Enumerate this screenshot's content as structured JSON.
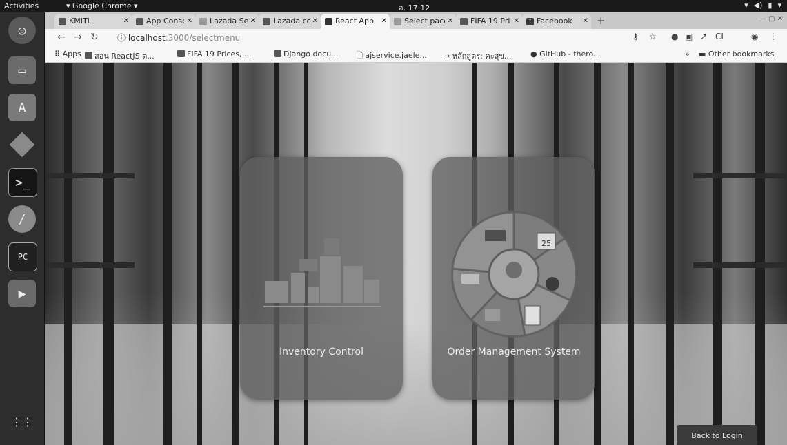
{
  "desktop": {
    "activities": "Activities",
    "app_menu": "Google Chrome",
    "clock": "อ. 17:12"
  },
  "tabs": [
    {
      "label": "KMITL"
    },
    {
      "label": "App Consol"
    },
    {
      "label": "Lazada Sel"
    },
    {
      "label": "Lazada.co"
    },
    {
      "label": "React App"
    },
    {
      "label": "Select pace"
    },
    {
      "label": "FIFA 19 Pri"
    },
    {
      "label": "Facebook"
    }
  ],
  "address": {
    "host": "localhost",
    "path": ":3000/selectmenu"
  },
  "bookmarks": [
    {
      "label": "Apps"
    },
    {
      "label": "สอน ReactJS ต..."
    },
    {
      "label": "FIFA 19 Prices, ..."
    },
    {
      "label": "Django docu..."
    },
    {
      "label": "ajservice.jaele..."
    },
    {
      "label": "หลักสูตร: คะสุข..."
    },
    {
      "label": "GitHub - thero..."
    },
    {
      "label": "Other bookmarks"
    }
  ],
  "page": {
    "inventory_label": "Inventory Control",
    "order_label": "Order Management System",
    "calendar_day": "25",
    "back_button": "Back to Login"
  },
  "accent_colors": {
    "card": "#5f5f5f",
    "button": "#3b3b3b"
  }
}
